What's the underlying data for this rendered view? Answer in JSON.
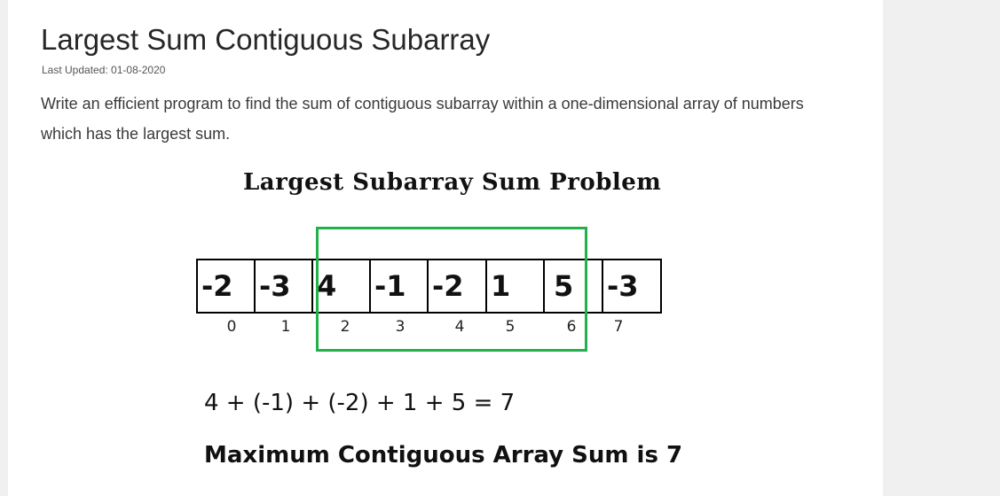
{
  "article": {
    "title": "Largest Sum Contiguous Subarray",
    "last_updated": "Last Updated: 01-08-2020",
    "description": "Write an efficient program to find the sum of contiguous subarray within a one-dimensional array of numbers which has the largest sum."
  },
  "figure": {
    "title": "Largest Subarray Sum Problem",
    "cells": [
      "-2",
      "-3",
      "4",
      "-1",
      "-2",
      "1",
      "5",
      "-3"
    ],
    "indices": [
      "0",
      "1",
      "2",
      "3",
      "4",
      "5",
      "6",
      "7"
    ],
    "equation": "4 + (-1) + (-2) + 1 + 5 = 7",
    "result": "Maximum Contiguous Array Sum is 7",
    "highlight_color": "#22b04a"
  }
}
